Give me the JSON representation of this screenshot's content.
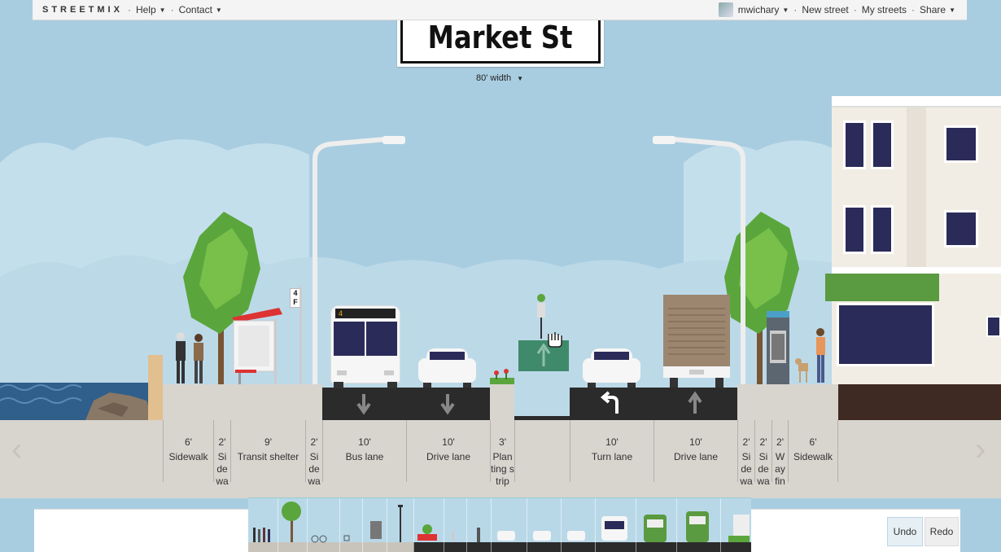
{
  "app": {
    "brand": "STREETMIX",
    "nav": [
      {
        "label": "Help"
      },
      {
        "label": "Contact"
      }
    ],
    "user": {
      "name": "mwichary"
    },
    "right_links": [
      {
        "label": "New street"
      },
      {
        "label": "My streets"
      },
      {
        "label": "Share"
      }
    ]
  },
  "street": {
    "name": "Market St",
    "width_label": "80' width"
  },
  "segments": [
    {
      "width": "6'",
      "name": "Sidewalk"
    },
    {
      "width": "2'",
      "name": "Si de wa"
    },
    {
      "width": "9'",
      "name": "Transit shelter"
    },
    {
      "width": "2'",
      "name": "Si de wa"
    },
    {
      "width": "10'",
      "name": "Bus lane"
    },
    {
      "width": "10'",
      "name": "Drive lane"
    },
    {
      "width": "3'",
      "name": "Plan ting strip"
    },
    {
      "width": "",
      "name": ""
    },
    {
      "width": "10'",
      "name": "Turn lane"
    },
    {
      "width": "10'",
      "name": "Drive lane"
    },
    {
      "width": "2'",
      "name": "Si de wa"
    },
    {
      "width": "2'",
      "name": "Si de wa"
    },
    {
      "width": "2'",
      "name": "W ay fin"
    },
    {
      "width": "6'",
      "name": "Sidewalk"
    }
  ],
  "bus_route": "4",
  "stop_sign": "4 F",
  "controls": {
    "undo": "Undo",
    "redo": "Redo"
  },
  "colors": {
    "sky": "#a9cde0",
    "asphalt": "#2b2b2b",
    "sidewalk": "#d8d4ce",
    "bike_lane": "#3f8a6a",
    "awning": "#5a9a40"
  }
}
